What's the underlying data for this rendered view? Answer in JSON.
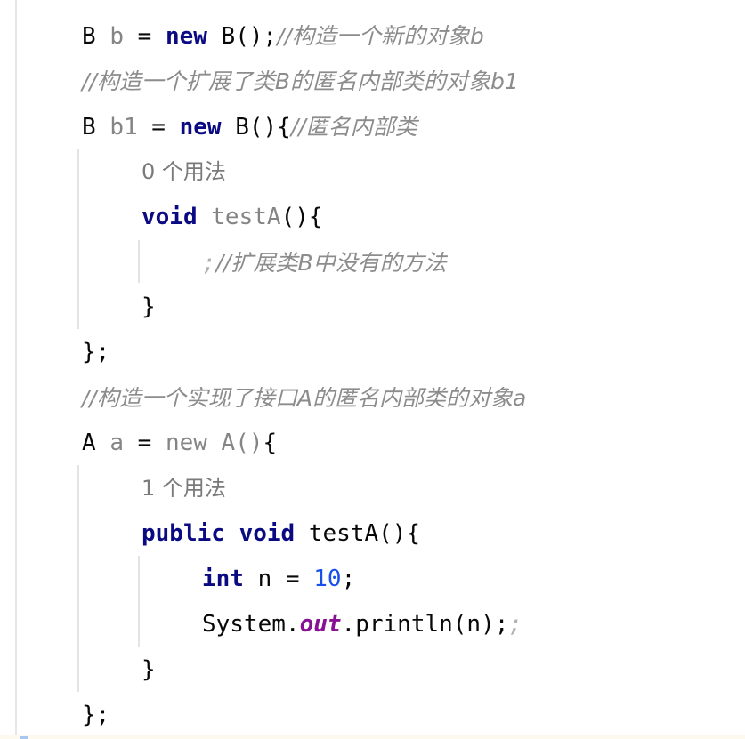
{
  "editor": {
    "theme_colors": {
      "keyword": "#0a0a82",
      "unused": "#858585",
      "number": "#1750eb",
      "static_field": "#871094",
      "comment": "#8c8c8c",
      "text": "#080808"
    },
    "lines": [
      {
        "id": "l1",
        "parts": [
          {
            "t": "B ",
            "c": "plain"
          },
          {
            "t": "b",
            "c": "unused"
          },
          {
            "t": " = ",
            "c": "plain"
          },
          {
            "t": "new",
            "c": "kw"
          },
          {
            "t": " B();",
            "c": "plain"
          },
          {
            "t": "//构造一个新的对象b",
            "c": "comment"
          }
        ]
      },
      {
        "id": "l2",
        "parts": [
          {
            "t": "//构造一个扩展了类B的匿名内部类的对象b1",
            "c": "comment"
          }
        ]
      },
      {
        "id": "l3",
        "parts": [
          {
            "t": "B ",
            "c": "plain"
          },
          {
            "t": "b1",
            "c": "unused"
          },
          {
            "t": " = ",
            "c": "plain"
          },
          {
            "t": "new",
            "c": "kw"
          },
          {
            "t": " B(){",
            "c": "plain"
          },
          {
            "t": "//匿名内部类",
            "c": "comment"
          }
        ]
      },
      {
        "id": "l4",
        "indent": 1,
        "parts": [
          {
            "t": "0 个用法",
            "c": "hint"
          }
        ]
      },
      {
        "id": "l5",
        "indent": 1,
        "parts": [
          {
            "t": "void",
            "c": "kw"
          },
          {
            "t": " ",
            "c": "plain"
          },
          {
            "t": "testA",
            "c": "unused"
          },
          {
            "t": "(){",
            "c": "plain"
          }
        ]
      },
      {
        "id": "l6",
        "indent": 2,
        "parts": [
          {
            "t": ";",
            "c": "semi-dim"
          },
          {
            "t": "//扩展类B中没有的方法",
            "c": "comment"
          }
        ]
      },
      {
        "id": "l7",
        "indent": 1,
        "parts": [
          {
            "t": "}",
            "c": "plain"
          }
        ]
      },
      {
        "id": "l8",
        "parts": [
          {
            "t": "};",
            "c": "plain"
          }
        ]
      },
      {
        "id": "l9",
        "parts": [
          {
            "t": "//构造一个实现了接口A的匿名内部类的对象a",
            "c": "comment"
          }
        ]
      },
      {
        "id": "l10",
        "parts": [
          {
            "t": "A ",
            "c": "plain"
          },
          {
            "t": "a",
            "c": "unused"
          },
          {
            "t": " = ",
            "c": "plain"
          },
          {
            "t": "new A()",
            "c": "unused"
          },
          {
            "t": "{",
            "c": "plain"
          }
        ]
      },
      {
        "id": "l11",
        "indent": 1,
        "parts": [
          {
            "t": "1 个用法",
            "c": "hint"
          }
        ]
      },
      {
        "id": "l12",
        "indent": 1,
        "parts": [
          {
            "t": "public",
            "c": "kw"
          },
          {
            "t": " ",
            "c": "plain"
          },
          {
            "t": "void",
            "c": "kw"
          },
          {
            "t": " testA(){",
            "c": "plain"
          }
        ]
      },
      {
        "id": "l13",
        "indent": 2,
        "parts": [
          {
            "t": "int",
            "c": "kw"
          },
          {
            "t": " n = ",
            "c": "plain"
          },
          {
            "t": "10",
            "c": "num"
          },
          {
            "t": ";",
            "c": "plain"
          }
        ]
      },
      {
        "id": "l14",
        "indent": 2,
        "parts": [
          {
            "t": "System.",
            "c": "plain"
          },
          {
            "t": "out",
            "c": "static-field"
          },
          {
            "t": ".println(n);",
            "c": "plain"
          },
          {
            "t": ";",
            "c": "semi-dim"
          }
        ]
      },
      {
        "id": "l15",
        "indent": 1,
        "parts": [
          {
            "t": "}",
            "c": "plain"
          }
        ]
      },
      {
        "id": "l16",
        "parts": [
          {
            "t": "};",
            "c": "plain"
          }
        ]
      }
    ]
  }
}
